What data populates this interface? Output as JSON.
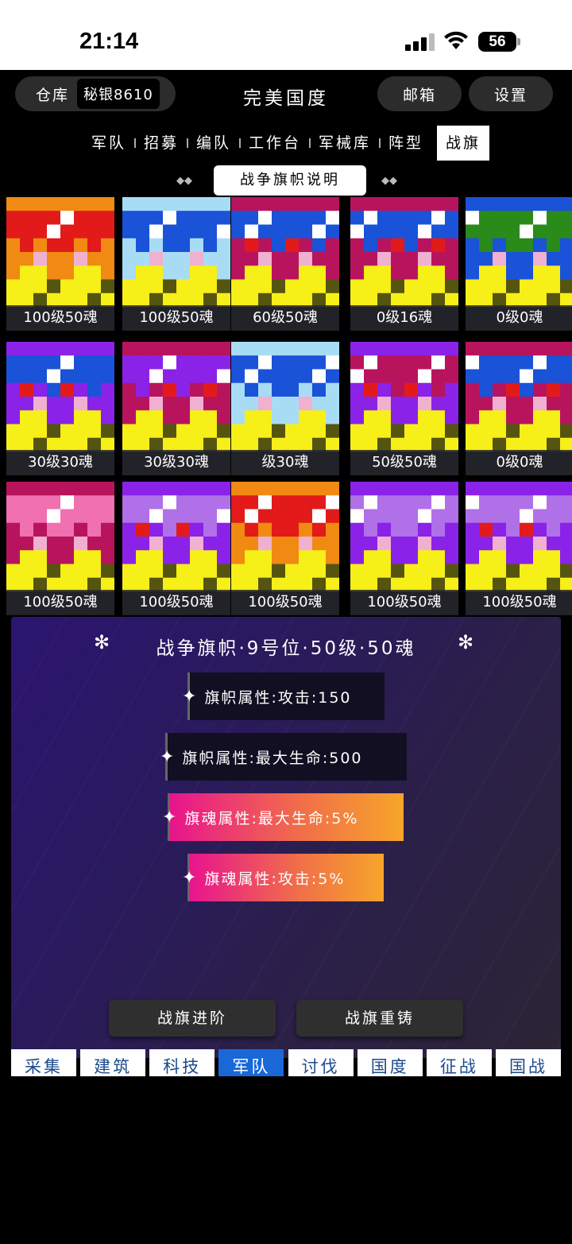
{
  "status": {
    "time": "21:14",
    "battery": "56"
  },
  "header": {
    "warehouse_label": "仓库",
    "silver_label": "秘银8610",
    "title": "完美国度",
    "mail_label": "邮箱",
    "settings_label": "设置"
  },
  "tabs": [
    {
      "label": "军队"
    },
    {
      "label": "招募"
    },
    {
      "label": "编队"
    },
    {
      "label": "工作台"
    },
    {
      "label": "军械库"
    },
    {
      "label": "阵型"
    },
    {
      "label": "战旗",
      "active": true
    }
  ],
  "explain_button": "战争旗帜说明",
  "flags": [
    {
      "label": "100级50魂",
      "colors": [
        "#f08a12",
        "#e21a1a",
        "#f7ef18"
      ]
    },
    {
      "label": "100级50魂",
      "colors": [
        "#a8dcf5",
        "#1a52d8",
        "#f7ef18"
      ]
    },
    {
      "label": "60级50魂",
      "colors": [
        "#b8145e",
        "#1a52d8",
        "#f7ef18"
      ]
    },
    {
      "label": "0级16魂",
      "colors": [
        "#b8145e",
        "#1a52d8",
        "#f7ef18"
      ]
    },
    {
      "label": "0级0魂",
      "colors": [
        "#1a52d8",
        "#2a8a1a",
        "#f7ef18"
      ]
    },
    {
      "label": "30级30魂",
      "colors": [
        "#8a22e8",
        "#1a52d8",
        "#f7ef18"
      ]
    },
    {
      "label": "30级30魂",
      "colors": [
        "#b8145e",
        "#8a22e8",
        "#f7ef18"
      ]
    },
    {
      "label": "级30魂",
      "colors": [
        "#a8dcf5",
        "#1a52d8",
        "#f7ef18"
      ]
    },
    {
      "label": "50级50魂",
      "colors": [
        "#8a22e8",
        "#b8145e",
        "#f7ef18"
      ]
    },
    {
      "label": "0级0魂",
      "colors": [
        "#b8145e",
        "#1a52d8",
        "#f7ef18"
      ]
    },
    {
      "label": "100级50魂",
      "colors": [
        "#b8145e",
        "#f070b0",
        "#f7ef18"
      ]
    },
    {
      "label": "100级50魂",
      "colors": [
        "#8a22e8",
        "#b070e8",
        "#f7ef18"
      ]
    },
    {
      "label": "100级50魂",
      "colors": [
        "#f08a12",
        "#e21a1a",
        "#f7ef18"
      ]
    },
    {
      "label": "100级50魂",
      "colors": [
        "#8a22e8",
        "#b070e8",
        "#f7ef18"
      ]
    },
    {
      "label": "100级50魂",
      "colors": [
        "#8a22e8",
        "#b070e8",
        "#f7ef18"
      ]
    }
  ],
  "panel": {
    "title": "战争旗帜·9号位·50级·50魂",
    "attrs": [
      {
        "text": "旗帜属性:攻击:150",
        "style": "dark"
      },
      {
        "text": "旗帜属性:最大生命:500",
        "style": "dark"
      },
      {
        "text": "旗魂属性:最大生命:5%",
        "style": "grad"
      },
      {
        "text": "旗魂属性:攻击:5%",
        "style": "grad"
      }
    ],
    "advance_label": "战旗进阶",
    "recast_label": "战旗重铸"
  },
  "bottom_nav": [
    {
      "label": "采集"
    },
    {
      "label": "建筑"
    },
    {
      "label": "科技"
    },
    {
      "label": "军队",
      "active": true
    },
    {
      "label": "讨伐"
    },
    {
      "label": "国度"
    },
    {
      "label": "征战"
    },
    {
      "label": "国战"
    }
  ]
}
